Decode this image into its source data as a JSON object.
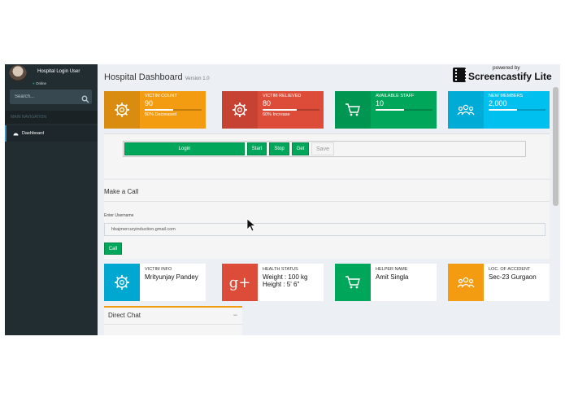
{
  "sidebar": {
    "user_name": "Hospital Login User",
    "user_status": "Online",
    "search_placeholder": "Search...",
    "nav_header": "MAIN NAVIGATION",
    "nav_items": [
      {
        "label": "Dashboard",
        "icon": "dashboard-icon"
      }
    ]
  },
  "header": {
    "title": "Hospital Dashboard",
    "version": "Version 1.0"
  },
  "watermark": {
    "small": "powered by",
    "big": "Screencastify Lite"
  },
  "stats": [
    {
      "label": "VICTIM COUNT",
      "value": "90",
      "desc": "50% Decreased",
      "progress": 0.5,
      "color": "#e08e0b",
      "icon": "gear-icon"
    },
    {
      "label": "VICTIM RELIEVED",
      "value": "80",
      "desc": "60% Increase",
      "progress": 0.6,
      "color": "#d73925",
      "icon": "gear-icon"
    },
    {
      "label": "AVAILABLE STAFF",
      "value": "10",
      "desc": "",
      "progress": 0.5,
      "color": "#008d4c",
      "icon": "cart-icon"
    },
    {
      "label": "NEW MEMBERS",
      "value": "2,000",
      "desc": "",
      "progress": 0.5,
      "color": "#0097bc",
      "icon": "users-icon"
    }
  ],
  "controls": {
    "login": "Login",
    "start": "Start",
    "stop": "Stop",
    "get": "Get",
    "save": "Save"
  },
  "call": {
    "title": "Make a Call",
    "field_label": "Enter Username",
    "username_value": "hbajmercuryinduction.gmail.com",
    "call_button": "Call"
  },
  "details": [
    {
      "label": "VICTIM INFO",
      "lines": [
        "Mrityunjay Pandey"
      ],
      "color": "#00a7d0",
      "icon": "gear-icon"
    },
    {
      "label": "HEALTH STATUS",
      "lines": [
        "Weight : 100 kg",
        "Height : 5' 6\""
      ],
      "color": "#dd4b39",
      "icon": "google-plus-icon"
    },
    {
      "label": "HELPER NAME",
      "lines": [
        "Amit Singla"
      ],
      "color": "#00a65a",
      "icon": "cart-icon"
    },
    {
      "label": "LOC. OF ACCIDENT",
      "lines": [
        "Sec-23 Gurgaon"
      ],
      "color": "#f39c12",
      "icon": "users-icon"
    }
  ],
  "chat": {
    "title": "Direct Chat",
    "collapse": "−"
  }
}
